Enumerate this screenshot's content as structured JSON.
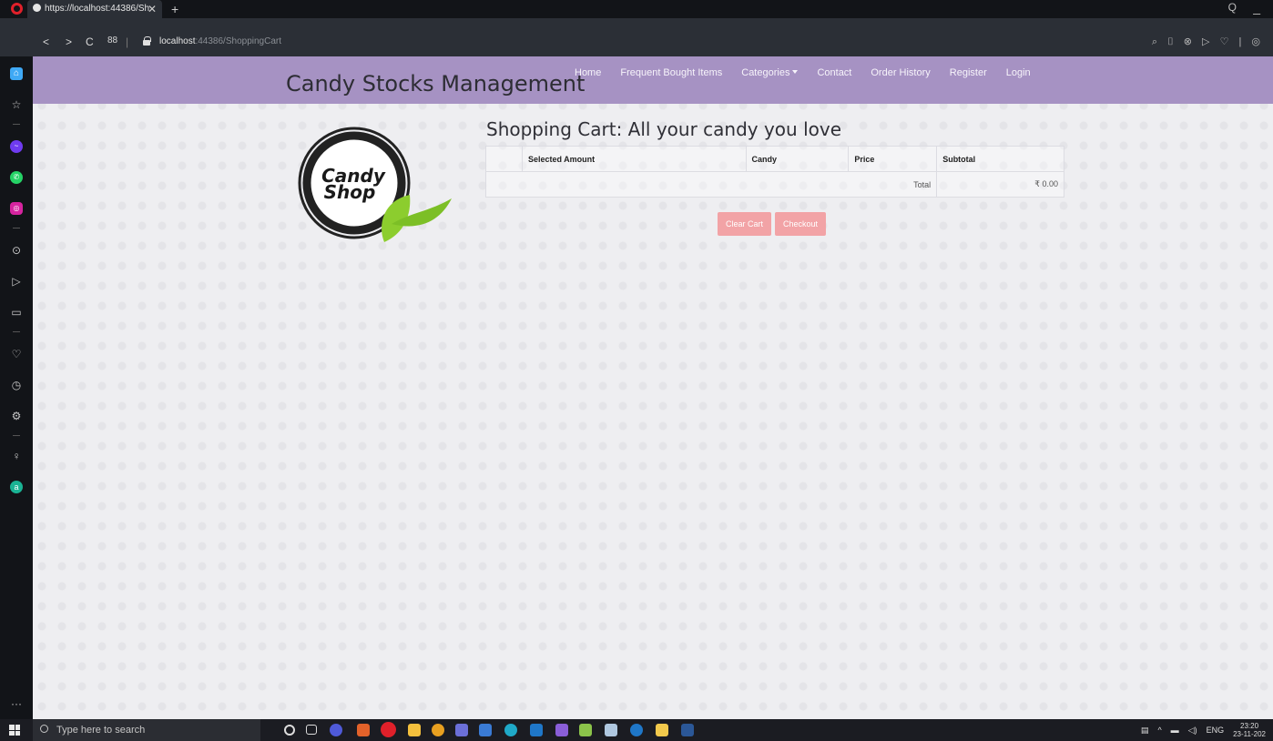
{
  "browser": {
    "tab_title": "https://localhost:44386/Sh",
    "tab_close": "✕",
    "new_tab": "+",
    "url_host": "localhost",
    "url_path": ":44386/ShoppingCart",
    "nav_back": "<",
    "nav_forward": ">",
    "nav_reload": "C",
    "speed_dial": "88",
    "divider": "|",
    "right_icons": "⌕ ⌷ ⊗ ▷ ♡ | ◎"
  },
  "site": {
    "brand": "Candy Stocks Management",
    "nav": [
      {
        "label": "Home"
      },
      {
        "label": "Frequent Bought Items"
      },
      {
        "label": "Categories"
      },
      {
        "label": "Contact"
      },
      {
        "label": "Order History"
      },
      {
        "label": "Register"
      },
      {
        "label": "Login"
      }
    ],
    "logo": {
      "line1": "Candy",
      "line2": "Shop"
    }
  },
  "cart": {
    "heading": "Shopping Cart: All your candy you love",
    "columns": [
      "Selected Amount",
      "Candy",
      "Price",
      "Subtotal"
    ],
    "total_label": "Total",
    "total_value": "₹ 0.00",
    "clear_label": "Clear Cart",
    "checkout_label": "Checkout"
  },
  "taskbar": {
    "search_placeholder": "Type here to search",
    "lang": "ENG",
    "time": "23:20",
    "date": "23-11-202"
  },
  "colors": {
    "navbar": "#a692c3",
    "button": "#f2a3a6",
    "tab_strip": "#121418"
  }
}
